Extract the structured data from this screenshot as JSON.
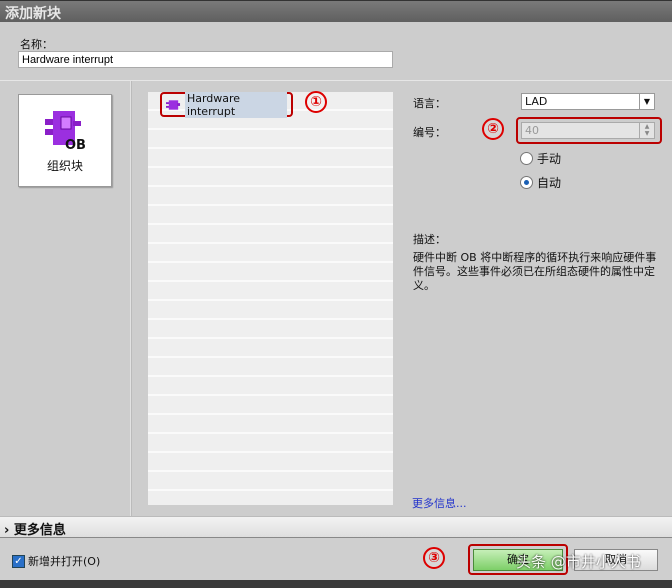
{
  "dialog": {
    "title": "添加新块"
  },
  "name": {
    "label": "名称：",
    "value": "Hardware interrupt"
  },
  "block_type": {
    "label": "组织块",
    "icon_text": "OB"
  },
  "list": {
    "items": [
      {
        "label": "Hardware interrupt",
        "selected": true
      }
    ]
  },
  "annotations": {
    "one": "①",
    "two": "②",
    "three": "③"
  },
  "settings": {
    "language_label": "语言：",
    "language_value": "LAD",
    "number_label": "编号：",
    "number_value": "40",
    "radio_manual": "手动",
    "radio_auto": "自动",
    "selected": "自动"
  },
  "description": {
    "label": "描述：",
    "text": "硬件中断 OB 将中断程序的循环执行来响应硬件事件信号。这些事件必须已在所组态硬件的属性中定义。",
    "more_link": "更多信息..."
  },
  "more_info": {
    "label": "更多信息"
  },
  "footer": {
    "add_open_label": "新增并打开(O)",
    "add_open_checked": true,
    "ok": "确定",
    "cancel": "取消"
  },
  "watermark": "头条 @市井小人书"
}
